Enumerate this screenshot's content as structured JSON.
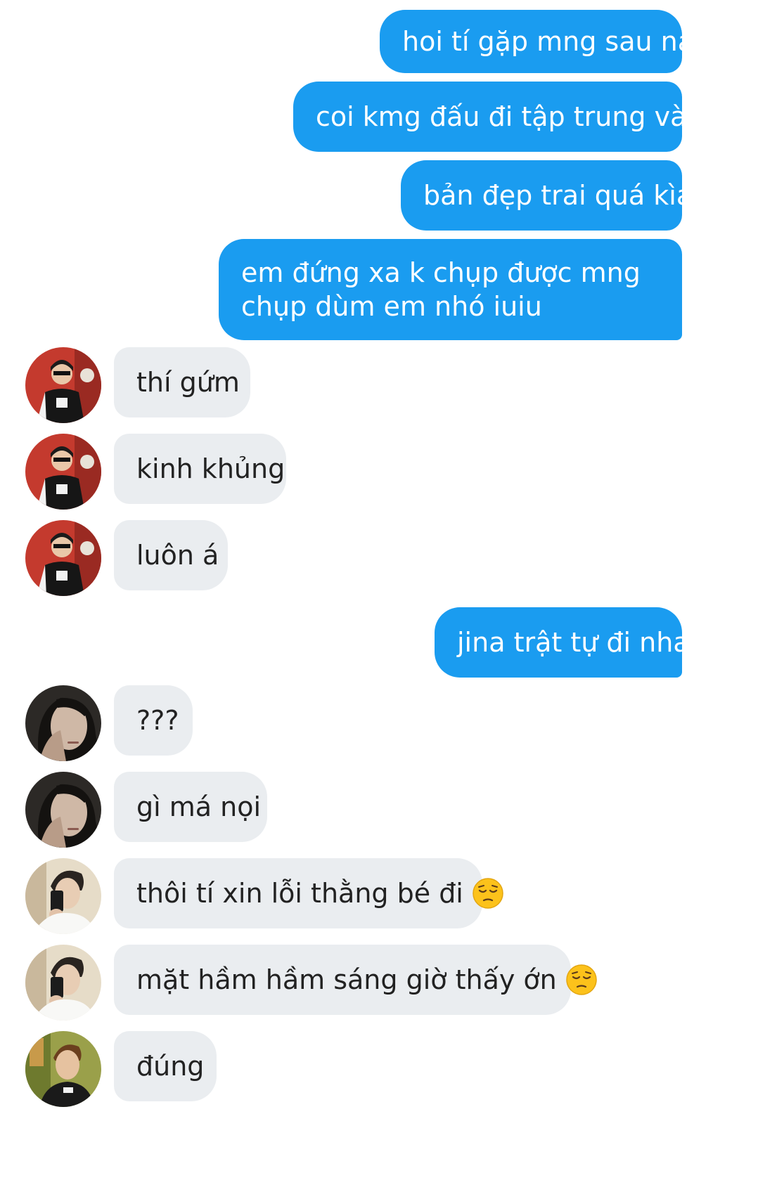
{
  "colors": {
    "outgoing_bubble": "#1a9cf0",
    "incoming_bubble": "#eaedf0",
    "incoming_text": "#222222",
    "outgoing_text": "#ffffff"
  },
  "messages": [
    {
      "side": "out",
      "text": "hoi tí gặp mng sau nà"
    },
    {
      "side": "out",
      "text": "coi kmg đấu đi tập trung vào"
    },
    {
      "side": "out",
      "text": "bản đẹp trai quá kìa"
    },
    {
      "side": "out",
      "lines": [
        "em đứng xa k chụp được mng",
        "chụp dùm em nhó iuiu"
      ]
    },
    {
      "side": "in",
      "avatar": "avatar-user-1",
      "text": "thí gứm"
    },
    {
      "side": "in",
      "avatar": "avatar-user-1",
      "text": "kinh khủng"
    },
    {
      "side": "in",
      "avatar": "avatar-user-1",
      "text": "luôn á"
    },
    {
      "side": "out",
      "text": "jina trật tự đi nha"
    },
    {
      "side": "in",
      "avatar": "avatar-user-2",
      "text": "???"
    },
    {
      "side": "in",
      "avatar": "avatar-user-2",
      "text": "gì má nọi"
    },
    {
      "side": "in",
      "avatar": "avatar-user-3",
      "text": "thôi tí xin lỗi thằng bé đi",
      "emoji": "pensive-face-icon"
    },
    {
      "side": "in",
      "avatar": "avatar-user-3",
      "text": "mặt hầm hầm sáng giờ thấy ớn",
      "emoji": "pensive-face-icon"
    },
    {
      "side": "in",
      "avatar": "avatar-user-4",
      "text": "đúng"
    }
  ]
}
